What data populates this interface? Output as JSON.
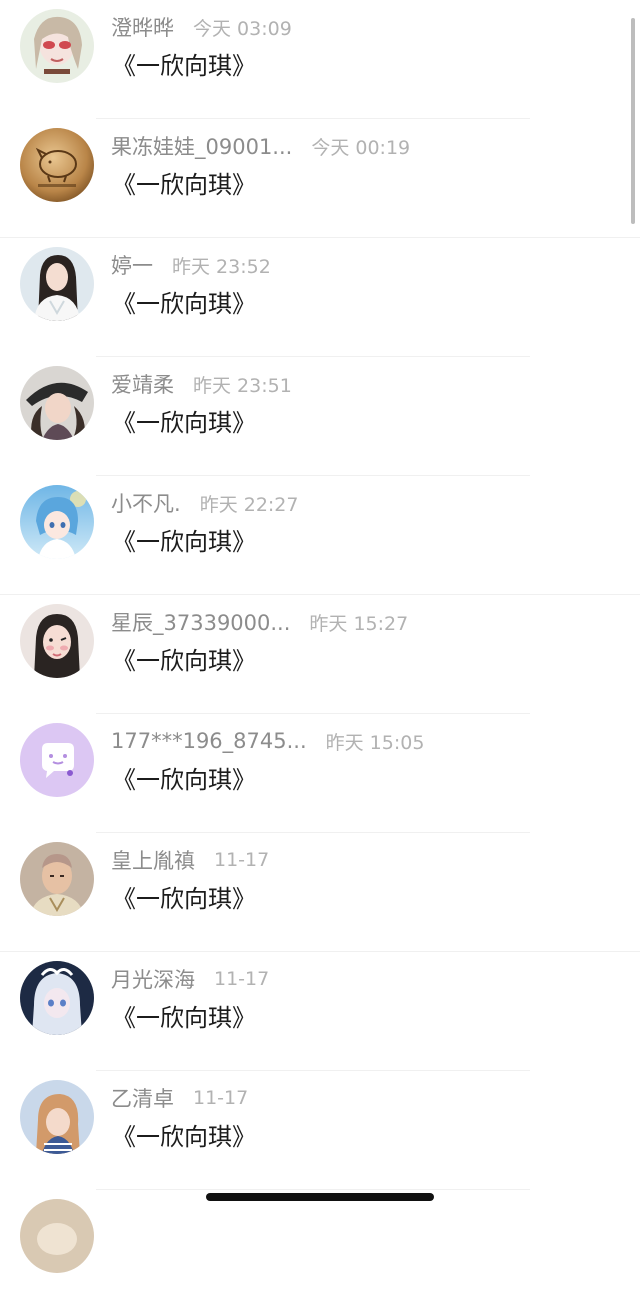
{
  "comments": [
    {
      "avatar_icon": "avatar-anime-girl-red-glasses-icon",
      "name": "澄晔晔",
      "time": "今天 03:09",
      "content": "《一欣向琪》"
    },
    {
      "avatar_icon": "avatar-golden-pig-emblem-icon",
      "name": "果冻娃娃_09001...",
      "time": "今天 00:19",
      "content": "《一欣向琪》"
    },
    {
      "avatar_icon": "avatar-girl-white-dress-icon",
      "name": "婷一",
      "time": "昨天 23:52",
      "content": "《一欣向琪》"
    },
    {
      "avatar_icon": "avatar-girl-with-hat-icon",
      "name": "爱靖柔",
      "time": "昨天 23:51",
      "content": "《一欣向琪》"
    },
    {
      "avatar_icon": "avatar-anime-blue-hair-girl-icon",
      "name": "小不凡.",
      "time": "昨天 22:27",
      "content": "《一欣向琪》"
    },
    {
      "avatar_icon": "avatar-girl-braids-icon",
      "name": "星辰_37339000...",
      "time": "昨天 15:27",
      "content": "《一欣向琪》"
    },
    {
      "avatar_icon": "avatar-default-purple-chat-icon",
      "name": "177***196_8745...",
      "time": "昨天 15:05",
      "content": "《一欣向琪》"
    },
    {
      "avatar_icon": "avatar-qing-dynasty-man-icon",
      "name": "皇上胤禛",
      "time": "11-17",
      "content": "《一欣向琪》"
    },
    {
      "avatar_icon": "avatar-doll-white-hair-icon",
      "name": "月光深海",
      "time": "11-17",
      "content": "《一欣向琪》"
    },
    {
      "avatar_icon": "avatar-girl-selfie-icon",
      "name": "乙清卓",
      "time": "11-17",
      "content": "《一欣向琪》"
    },
    {
      "avatar_icon": "avatar-partial-icon",
      "name": "",
      "time": "",
      "content": ""
    }
  ],
  "colors": {
    "name": "#8c8c8c",
    "time": "#b2b2b2",
    "content": "#1c1c1c",
    "divider": "#f0f0f0",
    "default_avatar_bg": "#dcc7f3"
  }
}
